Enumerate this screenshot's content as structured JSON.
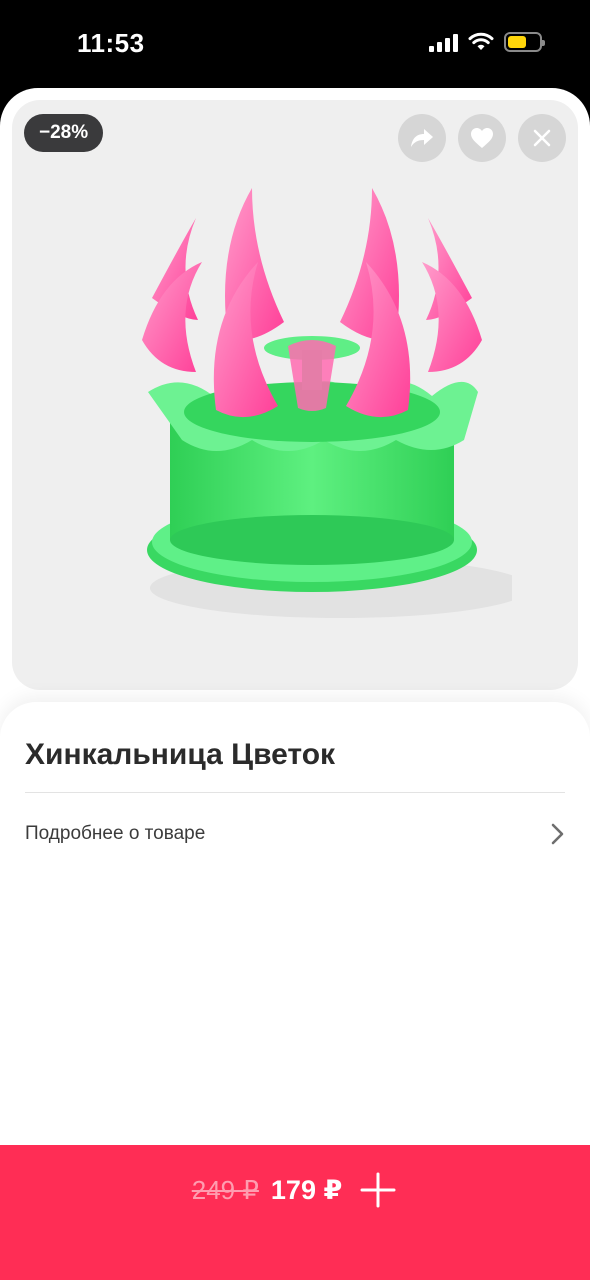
{
  "status_bar": {
    "time": "11:53"
  },
  "product": {
    "discount_badge": "−28%",
    "title": "Хинкальница Цветок",
    "details_link": "Подробнее о товаре"
  },
  "actions": {
    "share_icon": "share-icon",
    "favorite_icon": "heart-icon",
    "close_icon": "close-icon"
  },
  "buy_bar": {
    "old_price": "249 ₽",
    "new_price": "179 ₽",
    "add_icon": "plus-icon",
    "color": "#ff2d55"
  },
  "colors": {
    "badge_bg": "#3a3a3c",
    "photo_bg": "#efefef",
    "product_green": "#3ee06a",
    "product_pink": "#ff5fa6"
  }
}
